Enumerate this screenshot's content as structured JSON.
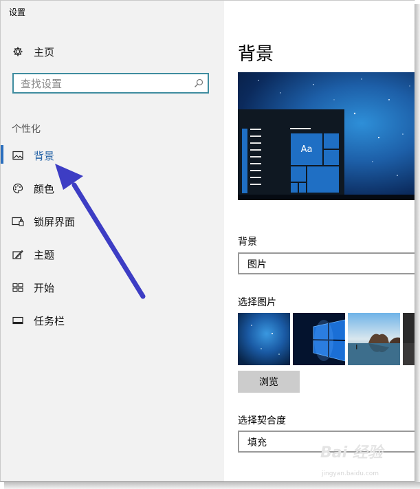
{
  "window": {
    "title": "设置"
  },
  "sidebar": {
    "home_label": "主页",
    "search_placeholder": "查找设置",
    "section_title": "个性化",
    "items": [
      {
        "label": "背景",
        "icon": "image-icon",
        "active": true
      },
      {
        "label": "颜色",
        "icon": "palette-icon"
      },
      {
        "label": "锁屏界面",
        "icon": "lock-screen-icon"
      },
      {
        "label": "主题",
        "icon": "theme-brush-icon"
      },
      {
        "label": "开始",
        "icon": "start-tiles-icon"
      },
      {
        "label": "任务栏",
        "icon": "taskbar-icon"
      }
    ]
  },
  "main": {
    "title": "背景",
    "preview_tile_text": "Aa",
    "background_label": "背景",
    "background_value": "图片",
    "choose_picture_label": "选择图片",
    "thumbnails": [
      "space-blue",
      "windows-10-hero",
      "beach-rocks",
      "dark-partial"
    ],
    "browse_label": "浏览",
    "fit_label": "选择契合度",
    "fit_value": "填充"
  },
  "watermark": {
    "text": "Bai 经验",
    "sub": "jingyan.baidu.com"
  },
  "colors": {
    "accent": "#2a66a8",
    "arrow": "#3d3dc4",
    "sidebar_bg": "#f2f2f2",
    "search_border": "#3e8c9f"
  }
}
